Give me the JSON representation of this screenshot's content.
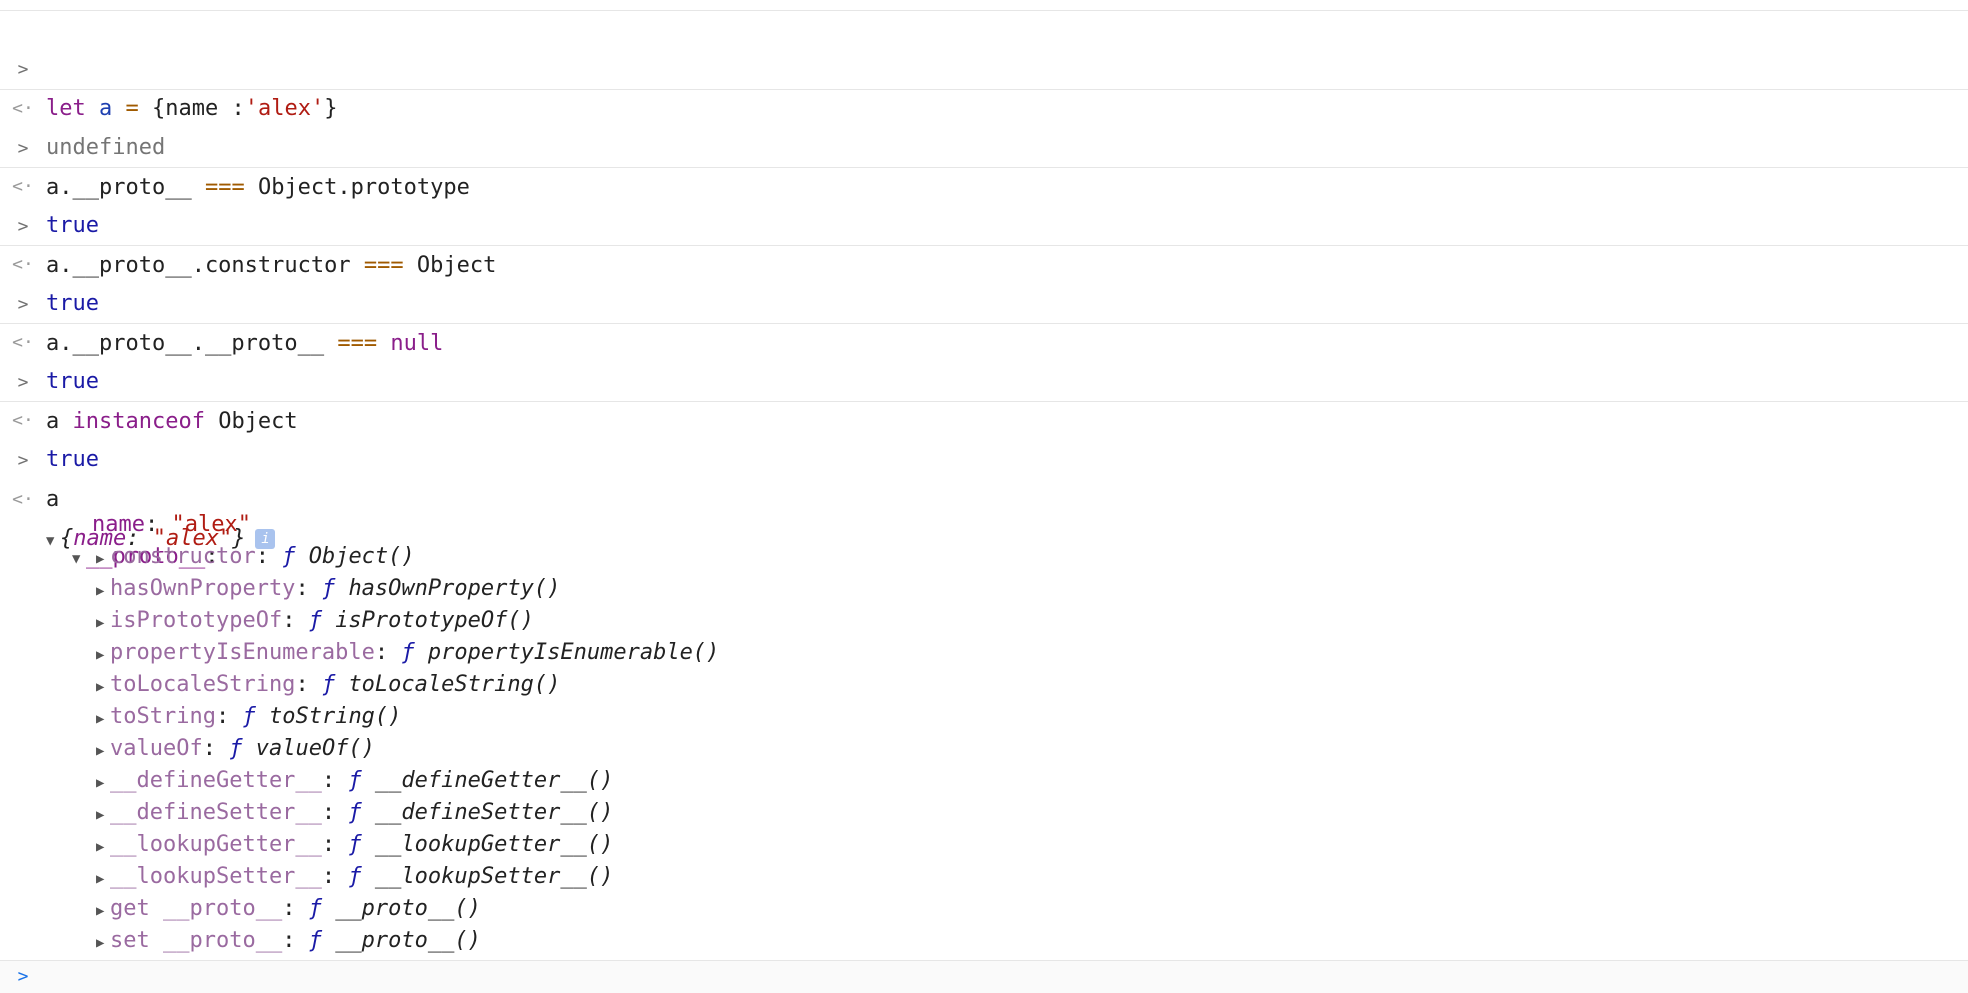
{
  "console": {
    "entries": [
      {
        "input": [
          "let",
          " ",
          "a",
          " ",
          "=",
          " {name :",
          "'alex'",
          "}"
        ],
        "output": "undefined"
      },
      {
        "input": [
          "a.__proto__",
          " ",
          "===",
          " Object.prototype"
        ],
        "output": "true"
      },
      {
        "input": [
          "a.__proto__.constructor",
          " ",
          "===",
          " Object"
        ],
        "output": "true"
      },
      {
        "input": [
          "a.__proto__.__proto__",
          " ",
          "===",
          " ",
          "null"
        ],
        "output": "true"
      },
      {
        "input": [
          "a ",
          "instanceof",
          " Object"
        ],
        "output": "true"
      },
      {
        "input": [
          "a"
        ],
        "output": ""
      }
    ],
    "object_preview": {
      "open_brace": "{",
      "key": "name",
      "colon": ": ",
      "value": "\"alex\"",
      "close_brace": "}",
      "info_badge": "i"
    },
    "own_property": {
      "key": "name",
      "value": "\"alex\""
    },
    "proto_label": "__proto__",
    "proto_items": [
      {
        "key": "constructor",
        "fn": "Object()"
      },
      {
        "key": "hasOwnProperty",
        "fn": "hasOwnProperty()"
      },
      {
        "key": "isPrototypeOf",
        "fn": "isPrototypeOf()"
      },
      {
        "key": "propertyIsEnumerable",
        "fn": "propertyIsEnumerable()"
      },
      {
        "key": "toLocaleString",
        "fn": "toLocaleString()"
      },
      {
        "key": "toString",
        "fn": "toString()"
      },
      {
        "key": "valueOf",
        "fn": "valueOf()"
      },
      {
        "key": "__defineGetter__",
        "fn": "__defineGetter__()"
      },
      {
        "key": "__defineSetter__",
        "fn": "__defineSetter__()"
      },
      {
        "key": "__lookupGetter__",
        "fn": "__lookupGetter__()"
      },
      {
        "key": "__lookupSetter__",
        "fn": "__lookupSetter__()"
      },
      {
        "key": "get __proto__",
        "fn": "__proto__()"
      },
      {
        "key": "set __proto__",
        "fn": "__proto__()"
      }
    ],
    "fn_marker": "ƒ",
    "gutter_input": ">",
    "gutter_output": "<·",
    "prompt_caret": ">"
  }
}
